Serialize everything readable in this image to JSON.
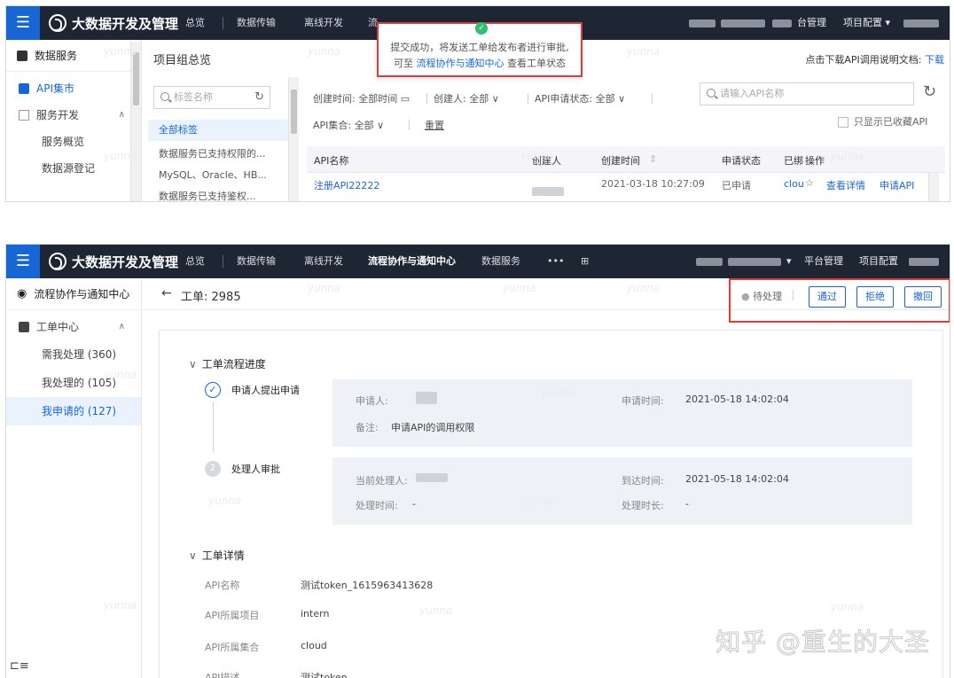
{
  "shot1": {
    "topbar": {
      "logo": "大数据开发及管理",
      "nav": [
        "总览",
        "数据传输",
        "离线开发",
        "流"
      ],
      "right": [
        "台管理",
        "项目配置 ▾"
      ]
    },
    "sidebar": {
      "header": "数据服务",
      "items": [
        {
          "label": "API集市",
          "active": true
        },
        {
          "label": "服务开发",
          "expandable": true
        },
        {
          "label": "服务概览"
        },
        {
          "label": "数据源登记"
        }
      ]
    },
    "group_panel": {
      "title": "项目组总览",
      "search_placeholder": "标签名称",
      "tags": [
        "全部标签",
        "数据服务已支持权限的...",
        "MySQL、Oracle、HB...",
        "数据服务已支持鉴权..."
      ]
    },
    "toast": {
      "line1": "提交成功，将发送工单给发布者进行审批,",
      "line2_prefix": "可至 ",
      "line2_link": "流程协作与通知中心",
      "line2_suffix": " 查看工单状态"
    },
    "doc_link": {
      "text": "点击下载API调用说明文档:",
      "link": "下载"
    },
    "filters": {
      "created_time": "创建时间: 全部时间",
      "creator": "创建人: 全部",
      "apply_status": "API申请状态: 全部",
      "api_set": "API集合: 全部",
      "reset": "重置",
      "search_placeholder": "请输入API名称",
      "only_fav": "只显示已收藏API"
    },
    "table": {
      "headers": [
        "API名称",
        "创建人",
        "创建时间",
        "申请状态",
        "已绑",
        "操作"
      ],
      "row": {
        "name": "注册API22222",
        "created": "2021-03-18 10:27:09",
        "status": "已申请",
        "bound": "clou",
        "actions": [
          "查看详情",
          "申请API"
        ]
      }
    }
  },
  "shot2": {
    "topbar": {
      "logo": "大数据开发及管理",
      "nav": [
        "总览",
        "数据传输",
        "离线开发",
        "流程协作与通知中心",
        "数据服务",
        "•••"
      ],
      "right": [
        "平台管理",
        "项目配置"
      ]
    },
    "sidebar": {
      "header": "流程协作与通知中心",
      "group": "工单中心",
      "items": [
        {
          "label": "需我处理 (360)"
        },
        {
          "label": "我处理的 (105)"
        },
        {
          "label": "我申请的 (127)",
          "selected": true
        }
      ]
    },
    "ticket": {
      "title": "工单: 2985",
      "status": "待处理",
      "buttons": [
        "通过",
        "拒绝",
        "撤回"
      ]
    },
    "progress": {
      "title": "工单流程进度",
      "steps": [
        {
          "num": "1",
          "label": "申请人提出申请",
          "fields": [
            {
              "label": "申请人:",
              "value": ""
            },
            {
              "label": "申请时间:",
              "value": "2021-05-18 14:02:04"
            },
            {
              "label": "备注:",
              "value": "申请API的调用权限"
            }
          ]
        },
        {
          "num": "2",
          "label": "处理人审批",
          "fields": [
            {
              "label": "当前处理人:",
              "value": ""
            },
            {
              "label": "到达时间:",
              "value": "2021-05-18 14:02:04"
            },
            {
              "label": "处理时间:",
              "value": "-"
            },
            {
              "label": "处理时长:",
              "value": "-"
            }
          ]
        }
      ]
    },
    "details": {
      "title": "工单详情",
      "rows": [
        {
          "label": "API名称",
          "value": "测试token_1615963413628"
        },
        {
          "label": "API所属项目",
          "value": "intern"
        },
        {
          "label": "API所属集合",
          "value": "cloud"
        },
        {
          "label": "API描述",
          "value": "测试token"
        }
      ]
    },
    "watermark": "知乎 @重生的大圣"
  },
  "watermark_text": "yunna",
  "colors": {
    "accent": "#1766d6",
    "topbar": "#1f2633",
    "highlight": "#e03a3a",
    "success": "#2fbf71"
  },
  "icons": [
    "menu-icon",
    "logo-icon",
    "search-icon",
    "refresh-icon",
    "check-circle-icon",
    "star-icon",
    "back-arrow-icon",
    "chevron-down-icon",
    "collapse-icon"
  ]
}
